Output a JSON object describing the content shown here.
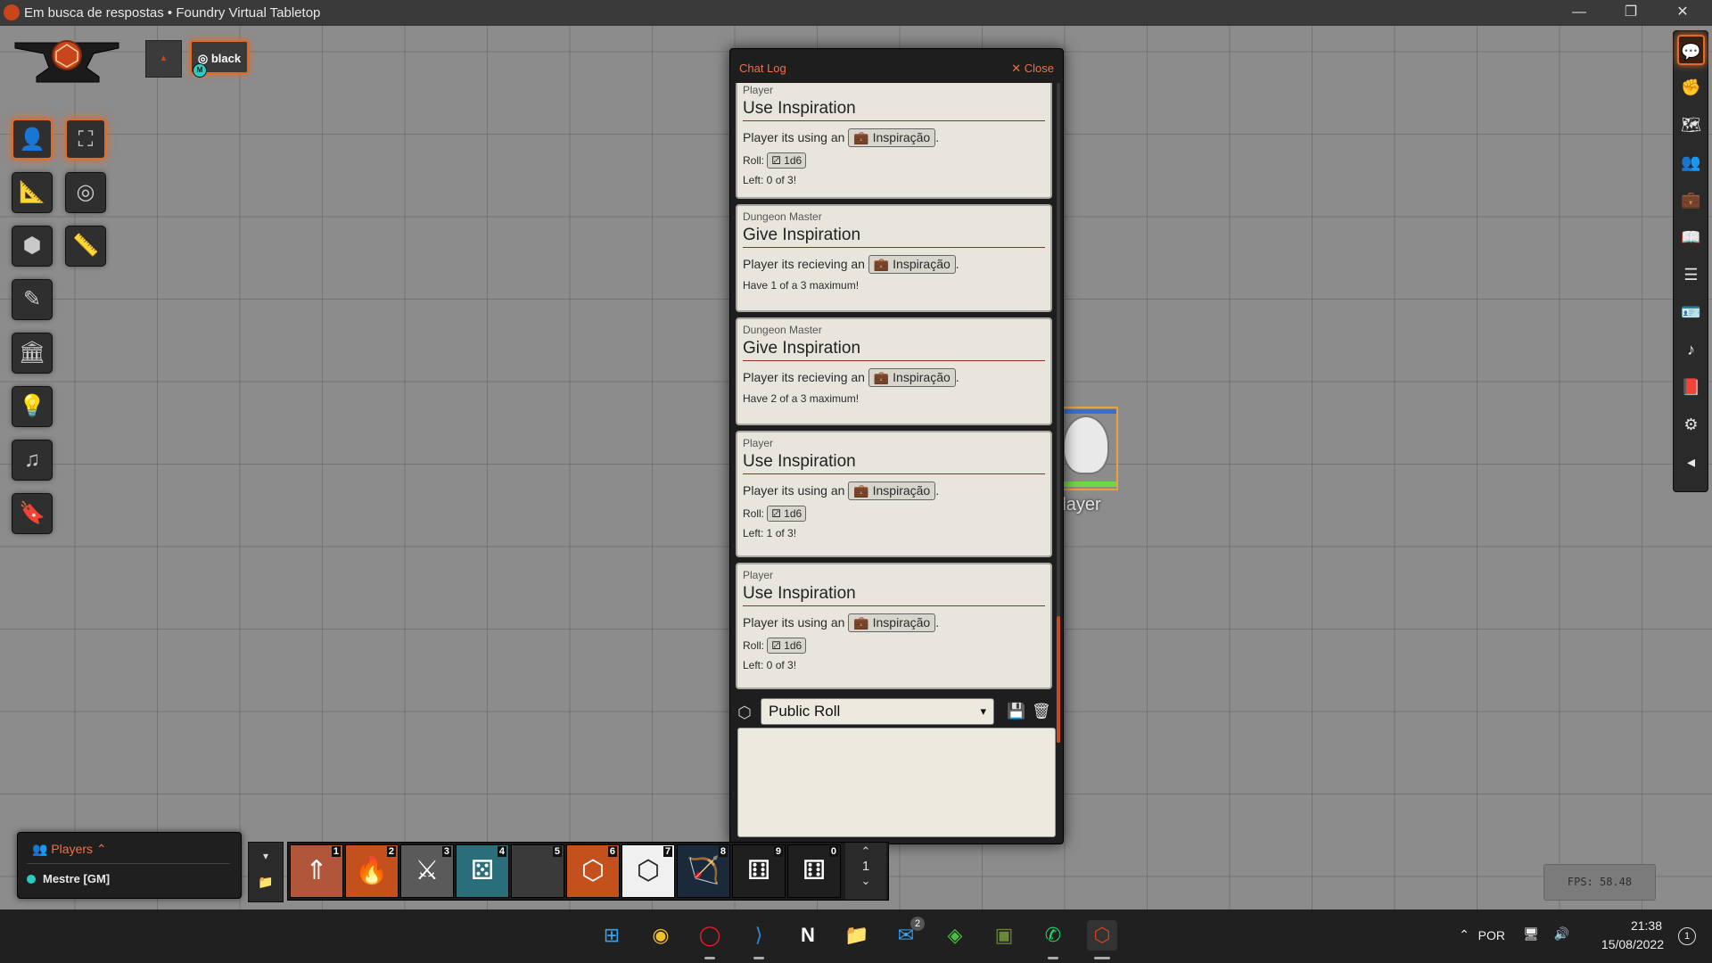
{
  "window": {
    "title": "Em busca de respostas • Foundry Virtual Tabletop",
    "minimize": "—",
    "restore": "❐",
    "close": "✕"
  },
  "scene_nav": {
    "toggle": "▲",
    "scene_name": "black",
    "user_badge": "M"
  },
  "controls": [
    {
      "name": "token-controls",
      "icon": "person-icon",
      "glyph": "👤"
    },
    {
      "name": "fullscreen-control",
      "icon": "expand-icon",
      "glyph": "⛶"
    },
    {
      "name": "measure-controls",
      "icon": "ruler-angle-icon",
      "glyph": "📐"
    },
    {
      "name": "target-control",
      "icon": "target-icon",
      "glyph": "◎"
    },
    {
      "name": "tile-controls",
      "icon": "cubes-icon",
      "glyph": "⬢"
    },
    {
      "name": "ruler-control",
      "icon": "ruler-icon",
      "glyph": "📏"
    },
    {
      "name": "drawing-controls",
      "icon": "pencil-icon",
      "glyph": "✎"
    },
    {
      "name": "wall-controls",
      "icon": "building-columns-icon",
      "glyph": "🏛"
    },
    {
      "name": "lighting-controls",
      "icon": "lightbulb-icon",
      "glyph": "💡"
    },
    {
      "name": "sound-controls",
      "icon": "music-icon",
      "glyph": "♫"
    },
    {
      "name": "notes-controls",
      "icon": "bookmark-icon",
      "glyph": "🔖"
    }
  ],
  "sidebar_tabs": [
    {
      "name": "chat",
      "icon": "comments-icon",
      "glyph": "💬"
    },
    {
      "name": "combat",
      "icon": "fist-icon",
      "glyph": "✊"
    },
    {
      "name": "scenes",
      "icon": "map-icon",
      "glyph": "🗺"
    },
    {
      "name": "actors",
      "icon": "users-icon",
      "glyph": "👥"
    },
    {
      "name": "items",
      "icon": "suitcase-icon",
      "glyph": "💼"
    },
    {
      "name": "journal",
      "icon": "book-open-icon",
      "glyph": "📖"
    },
    {
      "name": "tables",
      "icon": "th-list-icon",
      "glyph": "☰"
    },
    {
      "name": "cards",
      "icon": "id-badge-icon",
      "glyph": "🪪"
    },
    {
      "name": "playlists",
      "icon": "music-icon",
      "glyph": "♪"
    },
    {
      "name": "compendium",
      "icon": "atlas-icon",
      "glyph": "📕"
    },
    {
      "name": "settings",
      "icon": "cogs-icon",
      "glyph": "⚙"
    },
    {
      "name": "collapse",
      "icon": "caret-left-icon",
      "glyph": "◂"
    }
  ],
  "token": {
    "name": "Player"
  },
  "chat": {
    "title": "Chat Log",
    "close_label": "✕ Close",
    "roll_mode": "Public Roll",
    "messages": [
      {
        "author": "Player",
        "flavor": "Use Inspiration",
        "text": "Player its using an",
        "item": "Inspiração",
        "roll_label": "Roll:",
        "roll": "1d6",
        "footer": "Left: 0 of 3!"
      },
      {
        "author": "Dungeon Master",
        "flavor": "Give Inspiration",
        "text": "Player its recieving an",
        "item": "Inspiração",
        "roll_label": "",
        "roll": "",
        "footer": "Have 1 of a 3 maximum!"
      },
      {
        "author": "Dungeon Master",
        "flavor": "Give Inspiration",
        "text": "Player its recieving an",
        "item": "Inspiração",
        "roll_label": "",
        "roll": "",
        "footer": "Have 2 of a 3 maximum!"
      },
      {
        "author": "Player",
        "flavor": "Use Inspiration",
        "text": "Player its using an",
        "item": "Inspiração",
        "roll_label": "Roll:",
        "roll": "1d6",
        "footer": "Left: 1 of 3!"
      },
      {
        "author": "Player",
        "flavor": "Use Inspiration",
        "text": "Player its using an",
        "item": "Inspiração",
        "roll_label": "Roll:",
        "roll": "1d6",
        "footer": "Left: 0 of 3!"
      }
    ]
  },
  "players": {
    "header": "Players",
    "list": [
      {
        "name": "Mestre [GM]",
        "color": "#2ccbc0"
      }
    ]
  },
  "hotbar": {
    "page": "1",
    "slots": [
      {
        "num": "1",
        "icon": "arrows-up-icon",
        "bg": "#b0563a",
        "glyph": "⇑"
      },
      {
        "num": "2",
        "icon": "fire-icon",
        "bg": "#c4501e",
        "glyph": "🔥"
      },
      {
        "num": "3",
        "icon": "sword-icon",
        "bg": "#5a5a5a",
        "glyph": "⚔"
      },
      {
        "num": "4",
        "icon": "dice-icon",
        "bg": "#2a6e7a",
        "glyph": "⚄"
      },
      {
        "num": "5",
        "icon": "",
        "bg": "#3a3a3a",
        "glyph": ""
      },
      {
        "num": "6",
        "icon": "d20-orange-icon",
        "bg": "#c4501e",
        "glyph": "⬡"
      },
      {
        "num": "7",
        "icon": "d20-icon",
        "bg": "#f0f0f0",
        "glyph": "⬡"
      },
      {
        "num": "8",
        "icon": "bow-icon",
        "bg": "#1a2a3a",
        "glyph": "🏹"
      },
      {
        "num": "9",
        "icon": "d6-icon",
        "bg": "#1f1f1f",
        "glyph": "⚅"
      },
      {
        "num": "0",
        "icon": "d6-icon",
        "bg": "#1f1f1f",
        "glyph": "⚅"
      }
    ]
  },
  "fps": "FPS: 58.48",
  "taskbar": {
    "lang": "POR",
    "time": "21:38",
    "date": "15/08/2022",
    "mail_badge": "2",
    "notif_badge": "1"
  }
}
